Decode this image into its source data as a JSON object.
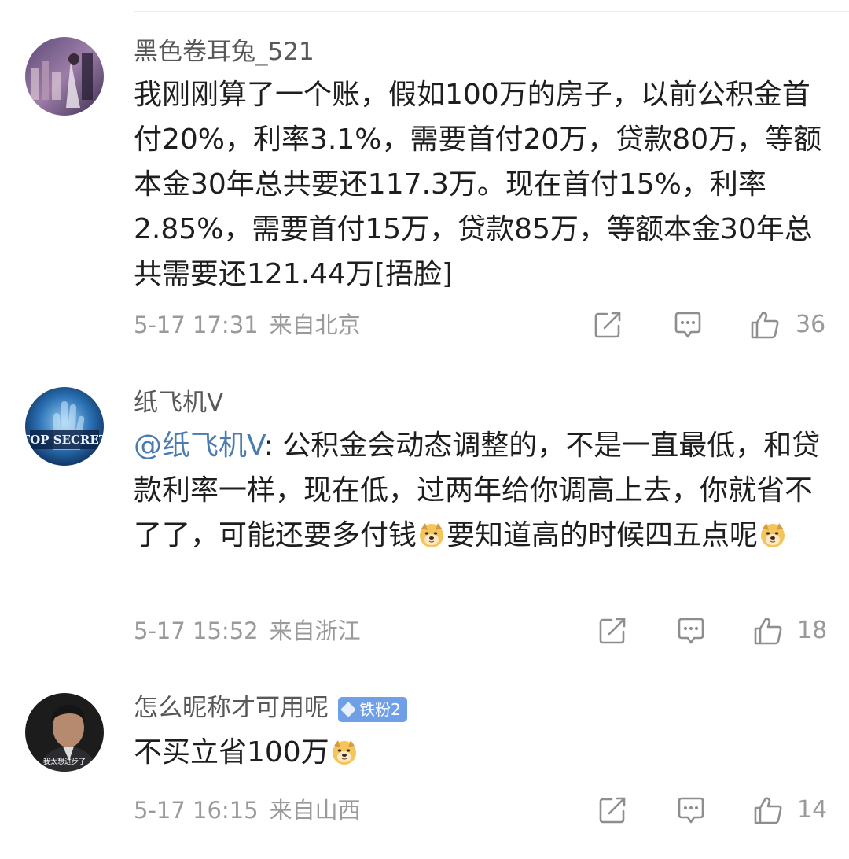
{
  "comments": [
    {
      "username": "黑色卷耳兔_521",
      "text": "我刚刚算了一个账，假如100万的房子，以前公积金首付20%，利率3.1%，需要首付20万，贷款80万，等额本金30年总共要还117.3万。现在首付15%，利率2.85%，需要首付15万，贷款85万，等额本金30年总共需要还121.44万[捂脸]",
      "date": "5-17 17:31",
      "location": "来自北京",
      "likes": "36"
    },
    {
      "username": "纸飞机V",
      "mention": "@纸飞机V",
      "text_a": ": 公积金会动态调整的，不是一直最低，和贷款利率一样，现在低，过两年给你调高上去，你就省不了了，可能还要多付钱",
      "emoji_1": "doge-emoji",
      "text_b": "要知道高的时候四五点呢",
      "emoji_2": "doge-emoji",
      "date": "5-17 15:52",
      "location": "来自浙江",
      "likes": "18"
    },
    {
      "username": "怎么昵称才可用呢",
      "badge": "铁粉2",
      "text": "不买立省100万",
      "emoji": "doge-emoji",
      "date": "5-17 16:15",
      "location": "来自山西",
      "likes": "14"
    }
  ],
  "avatar_2_text": "TOP SECRET",
  "avatar_3_text": "我太想进步了",
  "icons": {
    "repost": "repost-icon",
    "comment": "comment-icon",
    "like": "thumb-up-icon"
  },
  "colors": {
    "mention": "#4a7cae",
    "meta": "#9a9a9a",
    "badge": "#6f9fe6"
  }
}
